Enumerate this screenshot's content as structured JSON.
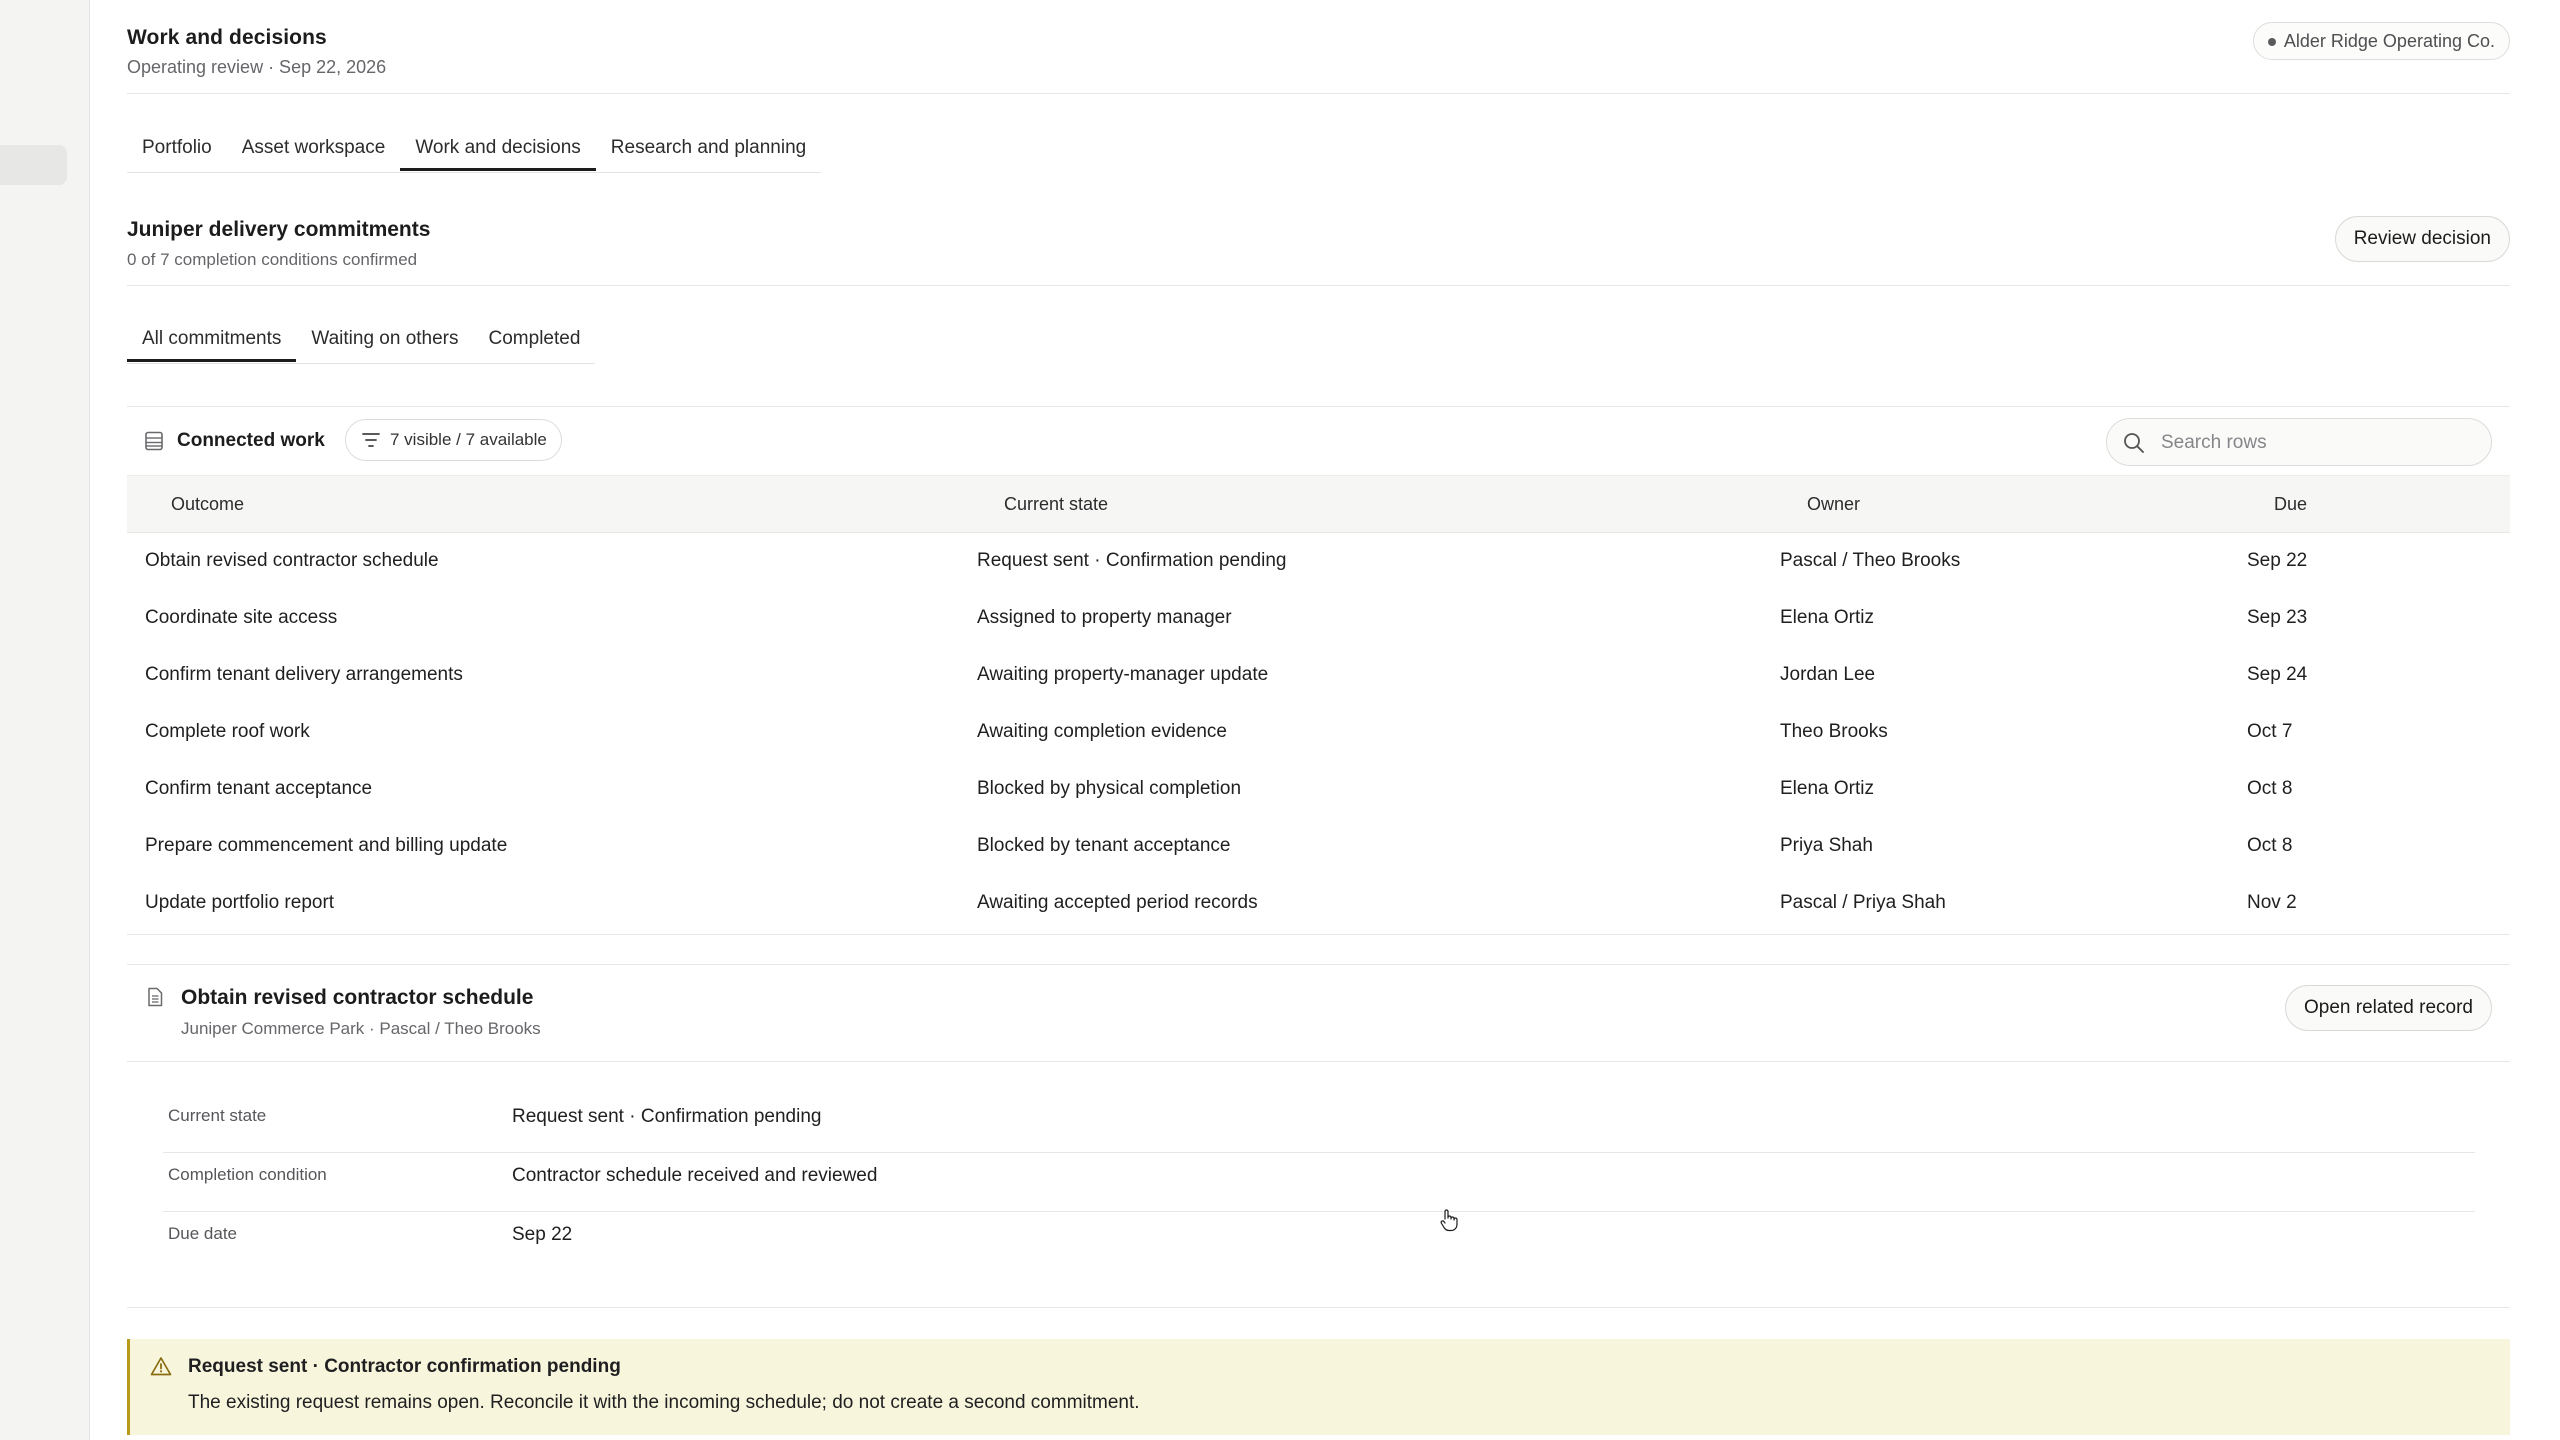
{
  "header": {
    "title": "Work and decisions",
    "subtitle": "Operating review · Sep 22, 2026",
    "organization": "Alder Ridge Operating Co."
  },
  "main_tabs": [
    {
      "label": "Portfolio",
      "active": false
    },
    {
      "label": "Asset workspace",
      "active": false
    },
    {
      "label": "Work and decisions",
      "active": true
    },
    {
      "label": "Research and planning",
      "active": false
    }
  ],
  "section": {
    "title": "Juniper delivery commitments",
    "subtitle": "0 of 7 completion conditions confirmed",
    "review_button": "Review decision"
  },
  "sub_tabs": [
    {
      "label": "All commitments",
      "active": true
    },
    {
      "label": "Waiting on others",
      "active": false
    },
    {
      "label": "Completed",
      "active": false
    }
  ],
  "connected_work": {
    "title": "Connected work",
    "filter_label": "7 visible / 7 available",
    "search_placeholder": "Search rows",
    "columns": [
      "Outcome",
      "Current state",
      "Owner",
      "Due"
    ],
    "rows": [
      [
        "Obtain revised contractor schedule",
        "Request sent · Confirmation pending",
        "Pascal / Theo Brooks",
        "Sep 22"
      ],
      [
        "Coordinate site access",
        "Assigned to property manager",
        "Elena Ortiz",
        "Sep 23"
      ],
      [
        "Confirm tenant delivery arrangements",
        "Awaiting property-manager update",
        "Jordan Lee",
        "Sep 24"
      ],
      [
        "Complete roof work",
        "Awaiting completion evidence",
        "Theo Brooks",
        "Oct 7"
      ],
      [
        "Confirm tenant acceptance",
        "Blocked by physical completion",
        "Elena Ortiz",
        "Oct 8"
      ],
      [
        "Prepare commencement and billing update",
        "Blocked by tenant acceptance",
        "Priya Shah",
        "Oct 8"
      ],
      [
        "Update portfolio report",
        "Awaiting accepted period records",
        "Pascal / Priya Shah",
        "Nov 2"
      ]
    ]
  },
  "detail": {
    "title": "Obtain revised contractor schedule",
    "subtitle": "Juniper Commerce Park · Pascal / Theo Brooks",
    "open_button": "Open related record",
    "fields": [
      {
        "label": "Current state",
        "value": "Request sent · Confirmation pending"
      },
      {
        "label": "Completion condition",
        "value": "Contractor schedule received and reviewed"
      },
      {
        "label": "Due date",
        "value": "Sep 22"
      }
    ]
  },
  "alert": {
    "icon": "warning-icon",
    "title": "Request sent · Contractor confirmation pending",
    "body": "The existing request remains open. Reconcile it with the incoming schedule; do not create a second commitment.",
    "accent_color": "#b89a1a",
    "background_color": "#f7f5dc"
  }
}
